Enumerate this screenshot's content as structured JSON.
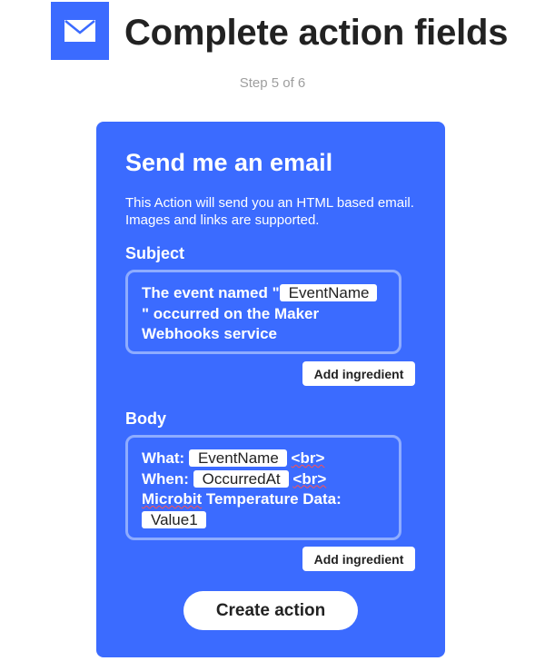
{
  "header": {
    "icon": "email-icon",
    "icon_color": "#3b6bff",
    "title": "Complete action fields",
    "step": "Step 5 of 6"
  },
  "card": {
    "bg_color": "#3b6bff",
    "title": "Send me an email",
    "description": "This Action will send you an HTML based email. Images and links are supported.",
    "subject": {
      "label": "Subject",
      "text_before": "The event named \"",
      "ingredient": "EventName",
      "text_after": "\" occurred on the Maker Webhooks service",
      "add_button": "Add ingredient"
    },
    "body": {
      "label": "Body",
      "what_label": "What:",
      "what_ingredient": "EventName",
      "br_tag": "<br>",
      "when_label": "When:",
      "when_ingredient": "OccurredAt",
      "microbit_word": "Microbit",
      "temp_text": "Temperature Data:",
      "value_ingredient": "Value1",
      "add_button": "Add ingredient"
    },
    "create_button": "Create action"
  }
}
